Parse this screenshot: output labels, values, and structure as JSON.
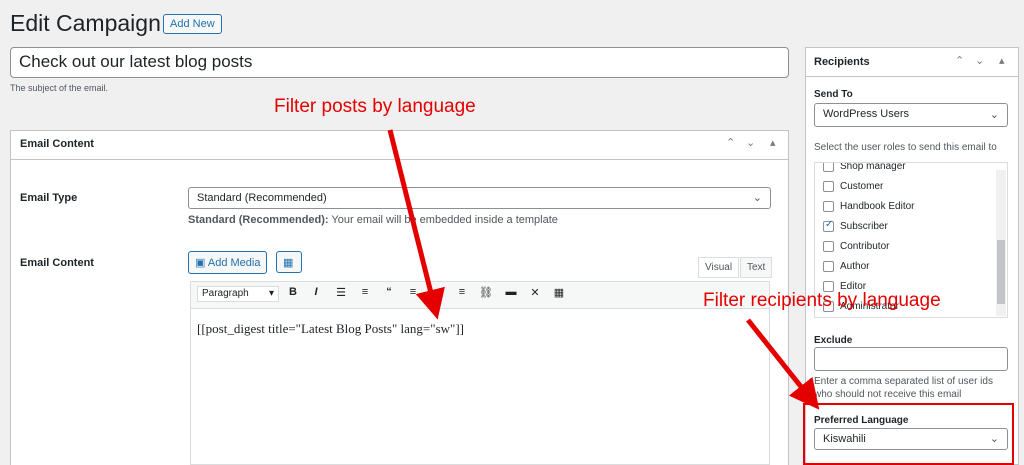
{
  "header": {
    "title": "Edit Campaign",
    "add_new": "Add New"
  },
  "subject": {
    "value": "Check out our latest blog posts",
    "help": "The subject of the email."
  },
  "email_content_box": {
    "title": "Email Content",
    "controls": {
      "up": "⌃",
      "down": "⌄",
      "toggle": "▴"
    },
    "email_type": {
      "label": "Email Type",
      "selected": "Standard (Recommended)",
      "help_bold": "Standard (Recommended):",
      "help_text": " Your email will be embedded inside a template"
    },
    "content": {
      "label": "Email Content",
      "add_media": "Add Media",
      "tabs": [
        "Visual",
        "Text"
      ],
      "paragraph": "Paragraph",
      "body": "[[post_digest title=\"Latest Blog Posts\" lang=\"sw\"]]"
    }
  },
  "sidebar": {
    "title": "Recipients",
    "send_to_label": "Send To",
    "send_to_value": "WordPress Users",
    "roles_help": "Select the user roles to send this email to",
    "roles": [
      {
        "label": "Shop manager",
        "checked": false
      },
      {
        "label": "Customer",
        "checked": false
      },
      {
        "label": "Handbook Editor",
        "checked": false
      },
      {
        "label": "Subscriber",
        "checked": true
      },
      {
        "label": "Contributor",
        "checked": false
      },
      {
        "label": "Author",
        "checked": false
      },
      {
        "label": "Editor",
        "checked": false
      },
      {
        "label": "Administrator",
        "checked": false
      }
    ],
    "exclude_label": "Exclude",
    "exclude_help": "Enter a comma separated list of user ids who should not receive this email",
    "pref_lang_label": "Preferred Language",
    "pref_lang_value": "Kiswahili"
  },
  "annotations": {
    "posts": "Filter posts by language",
    "recipients": "Filter recipients by language",
    "color": "#e50000"
  }
}
